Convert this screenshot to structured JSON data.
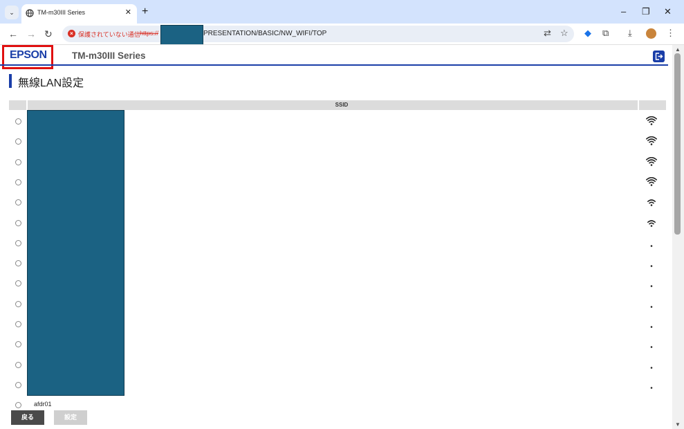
{
  "browser": {
    "tab_title": "TM-m30III Series",
    "tab_close": "✕",
    "new_tab": "+",
    "window": {
      "minimize": "–",
      "restore": "❐",
      "close": "✕"
    },
    "insecure_label": "保護されていない通信",
    "url_scheme": "https://",
    "url_path": "PRESENTATION/BASIC/NW_WIFI/TOP"
  },
  "header": {
    "brand": "EPSON",
    "product": "TM-m30III Series"
  },
  "page": {
    "title": "無線LAN設定",
    "ssid_header": "SSID"
  },
  "networks": [
    {
      "ssid": "",
      "signal_bars": 3
    },
    {
      "ssid": "",
      "signal_bars": 3
    },
    {
      "ssid": "",
      "signal_bars": 3
    },
    {
      "ssid": "",
      "signal_bars": 3
    },
    {
      "ssid": "",
      "signal_bars": 2
    },
    {
      "ssid": "",
      "signal_bars": 2
    },
    {
      "ssid": "",
      "signal_bars": 0
    },
    {
      "ssid": "",
      "signal_bars": 0
    },
    {
      "ssid": "",
      "signal_bars": 0
    },
    {
      "ssid": "",
      "signal_bars": 0
    },
    {
      "ssid": "",
      "signal_bars": 0
    },
    {
      "ssid": "",
      "signal_bars": 0
    },
    {
      "ssid": "",
      "signal_bars": 0
    },
    {
      "ssid": "",
      "signal_bars": 0
    },
    {
      "ssid": "afdr01",
      "signal_bars": 0
    }
  ],
  "buttons": {
    "back": "戻る",
    "set": "設定"
  },
  "colors": {
    "brand_blue": "#1a3ea8",
    "redaction": "#1b6283",
    "highlight_red": "#e01010"
  }
}
